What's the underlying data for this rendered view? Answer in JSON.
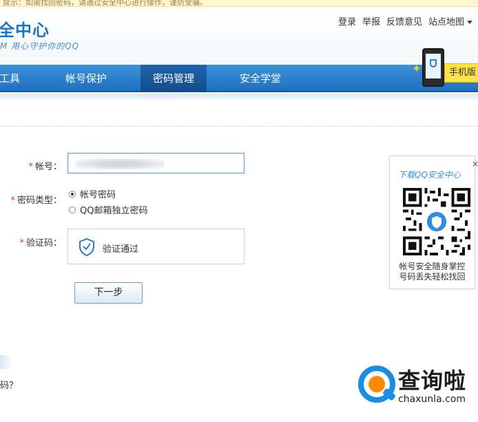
{
  "notice": {
    "text": "提示：如需找回密码，请通过安全中心进行操作，谨防受骗。"
  },
  "header": {
    "logo_title": "全中心",
    "logo_slogan": "M 用心守护你的QQ",
    "links": [
      "登录",
      "举报",
      "反馈意见",
      "站点地图"
    ]
  },
  "nav": {
    "items": [
      "工具",
      "帐号保护",
      "密码管理",
      "安全学堂"
    ],
    "active_index": 2
  },
  "promo": {
    "tag": "手机版"
  },
  "form": {
    "account_label": "帐号：",
    "account_value": "",
    "password_type_label": "密码类型：",
    "radio_options": [
      "帐号密码",
      "QQ邮箱独立密码"
    ],
    "radio_selected": 0,
    "captcha_label": "验证码：",
    "captcha_status": "验证通过",
    "next_button": "下一步",
    "required_mark": "*"
  },
  "left_fragment": {
    "question": "码？"
  },
  "qr_panel": {
    "title": "下载QQ安全中心",
    "close": "×",
    "caption_line1": "帐号安全随身掌控",
    "caption_line2": "号码丢失轻松找回"
  },
  "watermark": {
    "title": "查询啦",
    "domain": "chaxunla.com"
  },
  "colors": {
    "brand_blue": "#1f6fbf",
    "active_nav": "#134d8c",
    "required": "#e03030",
    "qr_title": "#3d8fd5"
  }
}
